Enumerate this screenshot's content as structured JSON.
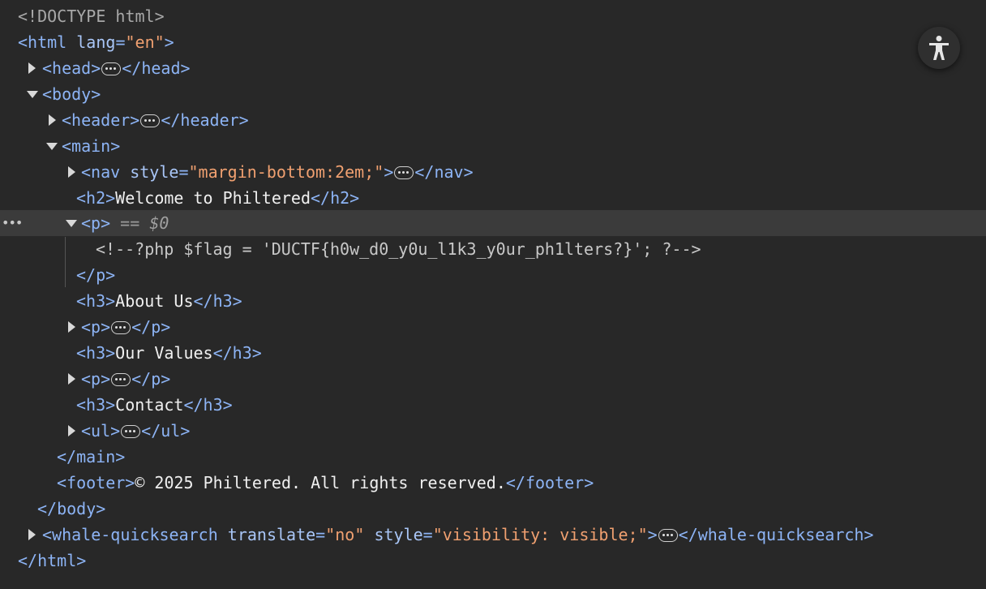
{
  "dom": {
    "doctype": "<!DOCTYPE html>",
    "html_open": "<html",
    "html_lang_attr": "lang",
    "html_lang_val": "\"en\"",
    "html_open_end": ">",
    "head_open": "<head>",
    "head_close": "</head>",
    "body_open": "<body>",
    "header_open": "<header>",
    "header_close": "</header>",
    "main_open": "<main>",
    "nav_open": "<nav",
    "nav_style_attr": "style",
    "nav_style_val": "\"margin-bottom:2em;\"",
    "nav_open_end": ">",
    "nav_close": "</nav>",
    "h2_open": "<h2>",
    "h2_text": "Welcome to Philtered",
    "h2_close": "</h2>",
    "p_open": "<p>",
    "selected_marker_eq": "==",
    "selected_marker_var": "$0",
    "php_comment": "<!--?php $flag = 'DUCTF{h0w_d0_y0u_l1k3_y0ur_ph1lters?}'; ?-->",
    "p_close": "</p>",
    "h3_open": "<h3>",
    "h3_close": "</h3>",
    "h3_about": "About Us",
    "h3_values": "Our Values",
    "h3_contact": "Contact",
    "ul_open": "<ul>",
    "ul_close": "</ul>",
    "main_close": "</main>",
    "footer_open": "<footer>",
    "footer_text": "© 2025 Philtered. All rights reserved.",
    "footer_close": "</footer>",
    "body_close": "</body>",
    "wq_open": "<whale-quicksearch",
    "wq_translate_attr": "translate",
    "wq_translate_val": "\"no\"",
    "wq_style_attr": "style",
    "wq_style_val": "\"visibility: visible;\"",
    "wq_open_end": ">",
    "wq_close": "</whale-quicksearch>",
    "html_close": "</html>",
    "gutter_dots": "•••"
  },
  "icons": {
    "accessibility": "accessibility-icon",
    "expand": "triangle-right-icon",
    "collapse": "triangle-down-icon",
    "ellipsis": "ellipsis-icon"
  },
  "colors": {
    "background": "#282828",
    "selected_row": "#3b3b3b",
    "tag": "#8db4f5",
    "attribute_value": "#f0a070"
  }
}
